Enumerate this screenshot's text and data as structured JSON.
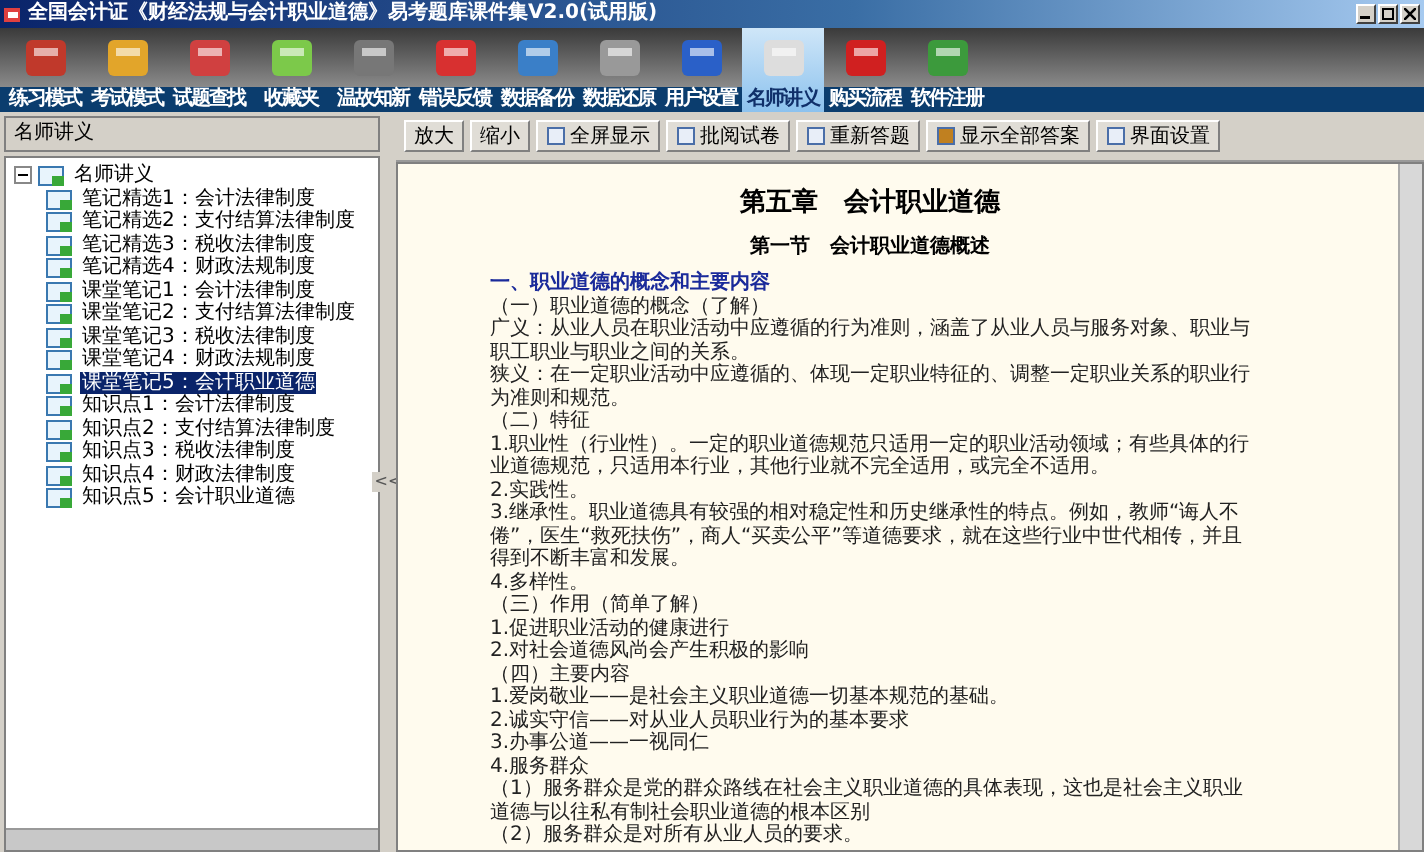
{
  "window": {
    "title": "全国会计证《财经法规与会计职业道德》易考题库课件集V2.0(试用版)"
  },
  "toolbar": [
    {
      "label": "练习模式",
      "selected": false
    },
    {
      "label": "考试模式",
      "selected": false
    },
    {
      "label": "试题查找",
      "selected": false
    },
    {
      "label": "收藏夹",
      "selected": false
    },
    {
      "label": "温故知新",
      "selected": false
    },
    {
      "label": "错误反馈",
      "selected": false
    },
    {
      "label": "数据备份",
      "selected": false
    },
    {
      "label": "数据还原",
      "selected": false
    },
    {
      "label": "用户设置",
      "selected": false
    },
    {
      "label": "名师讲义",
      "selected": true
    },
    {
      "label": "购买流程",
      "selected": false
    },
    {
      "label": "软件注册",
      "selected": false
    }
  ],
  "sidebar": {
    "title": "名师讲义",
    "splitter": "<<",
    "tree": [
      {
        "label": "名师讲义",
        "expanded": true,
        "selected": false,
        "children": [
          {
            "label": "笔记精选1：会计法律制度",
            "selected": false
          },
          {
            "label": "笔记精选2：支付结算法律制度",
            "selected": false
          },
          {
            "label": "笔记精选3：税收法律制度",
            "selected": false
          },
          {
            "label": "笔记精选4：财政法规制度",
            "selected": false
          },
          {
            "label": "课堂笔记1：会计法律制度",
            "selected": false
          },
          {
            "label": "课堂笔记2：支付结算法律制度",
            "selected": false
          },
          {
            "label": "课堂笔记3：税收法律制度",
            "selected": false
          },
          {
            "label": "课堂笔记4：财政法规制度",
            "selected": false
          },
          {
            "label": "课堂笔记5：会计职业道德",
            "selected": true
          },
          {
            "label": "知识点1：会计法律制度",
            "selected": false
          },
          {
            "label": "知识点2：支付结算法律制度",
            "selected": false
          },
          {
            "label": "知识点3：税收法律制度",
            "selected": false
          },
          {
            "label": "知识点4：财政法律制度",
            "selected": false
          },
          {
            "label": "知识点5：会计职业道德",
            "selected": false
          }
        ]
      }
    ]
  },
  "viewer_toolbar": [
    {
      "label": "放大",
      "kind": "text"
    },
    {
      "label": "缩小",
      "kind": "text"
    },
    {
      "label": "全屏显示",
      "kind": "fullscreen"
    },
    {
      "label": "批阅试卷",
      "kind": "grade"
    },
    {
      "label": "重新答题",
      "kind": "redo"
    },
    {
      "label": "显示全部答案",
      "kind": "answers"
    },
    {
      "label": "界面设置",
      "kind": "settings"
    }
  ],
  "document": [
    {
      "kind": "chapter",
      "text": "第五章　会计职业道德"
    },
    {
      "kind": "section",
      "text": "第一节　会计职业道德概述"
    },
    {
      "kind": "heading",
      "text": "一、职业道德的概念和主要内容"
    },
    {
      "kind": "text",
      "text": "（一）职业道德的概念（了解）"
    },
    {
      "kind": "text",
      "text": "广义：从业人员在职业活动中应遵循的行为准则，涵盖了从业人员与服务对象、职业与职工职业与职业之间的关系。"
    },
    {
      "kind": "text",
      "text": "狭义：在一定职业活动中应遵循的、体现一定职业特征的、调整一定职业关系的职业行为准则和规范。"
    },
    {
      "kind": "text",
      "text": "（二）特征"
    },
    {
      "kind": "text",
      "text": "1.职业性（行业性）。一定的职业道德规范只适用一定的职业活动领域；有些具体的行业道德规范，只适用本行业，其他行业就不完全适用，或完全不适用。"
    },
    {
      "kind": "text",
      "text": "2.实践性。"
    },
    {
      "kind": "text",
      "text": "3.继承性。职业道德具有较强的相对稳定性和历史继承性的特点。例如，教师“诲人不倦”，医生“救死扶伤”，商人“买卖公平”等道德要求，就在这些行业中世代相传，并且得到不断丰富和发展。"
    },
    {
      "kind": "text",
      "text": "4.多样性。"
    },
    {
      "kind": "text",
      "text": "（三）作用（简单了解）"
    },
    {
      "kind": "text",
      "text": "1.促进职业活动的健康进行"
    },
    {
      "kind": "text",
      "text": "2.对社会道德风尚会产生积极的影响"
    },
    {
      "kind": "text",
      "text": "（四）主要内容"
    },
    {
      "kind": "text",
      "text": "1.爱岗敬业——是社会主义职业道德一切基本规范的基础。"
    },
    {
      "kind": "text",
      "text": "2.诚实守信——对从业人员职业行为的基本要求"
    },
    {
      "kind": "text",
      "text": "3.办事公道——一视同仁"
    },
    {
      "kind": "text",
      "text": "4.服务群众"
    },
    {
      "kind": "text",
      "text": "（1）服务群众是党的群众路线在社会主义职业道德的具体表现，这也是社会主义职业道德与以往私有制社会职业道德的根本区别"
    },
    {
      "kind": "text",
      "text": "（2）服务群众是对所有从业人员的要求。"
    }
  ]
}
